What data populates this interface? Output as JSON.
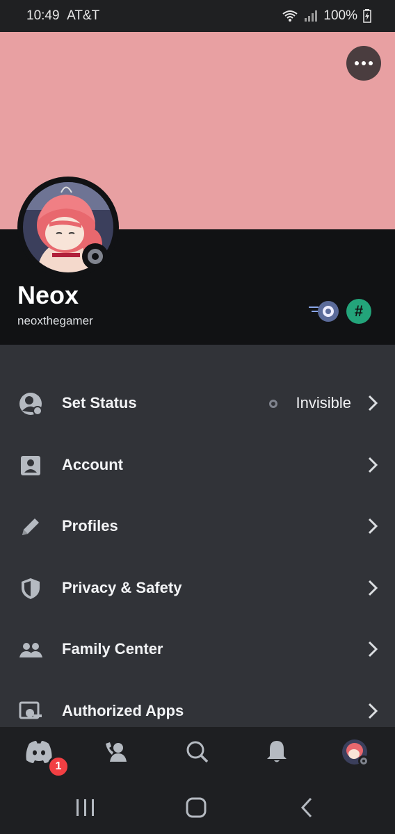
{
  "status_bar": {
    "time": "10:49",
    "carrier": "AT&T",
    "battery": "100%"
  },
  "profile": {
    "display_name": "Neox",
    "username": "neoxthegamer",
    "banner_color": "#e8a0a2",
    "badges": [
      "nitro-badge-icon",
      "hashtag-badge-icon"
    ]
  },
  "menu": {
    "items": [
      {
        "label": "Set Status",
        "value": "Invisible",
        "icon": "status-icon"
      },
      {
        "label": "Account",
        "icon": "account-icon"
      },
      {
        "label": "Profiles",
        "icon": "pencil-icon"
      },
      {
        "label": "Privacy & Safety",
        "icon": "shield-icon"
      },
      {
        "label": "Family Center",
        "icon": "family-icon"
      },
      {
        "label": "Authorized Apps",
        "icon": "apps-icon"
      }
    ]
  },
  "bottom_nav": {
    "notification_count": "1",
    "items": [
      "discord-home-icon",
      "friends-icon",
      "search-icon",
      "bell-icon",
      "profile-avatar"
    ]
  }
}
